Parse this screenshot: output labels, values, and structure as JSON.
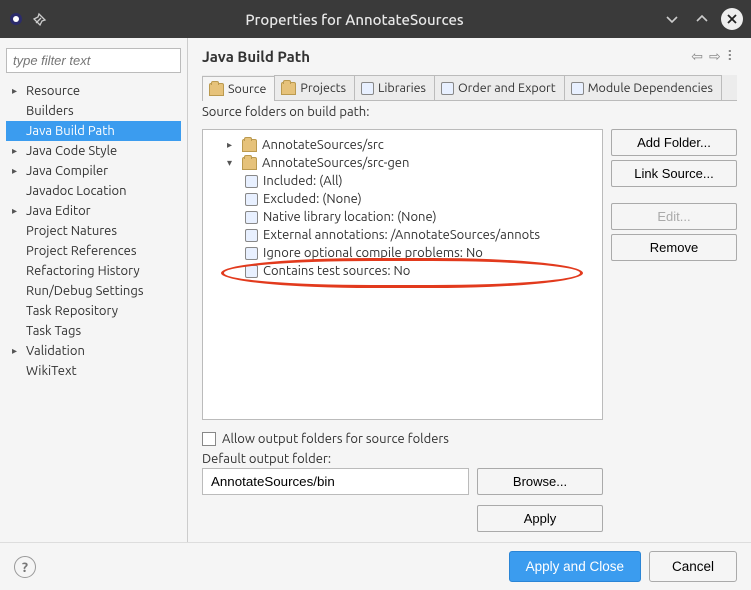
{
  "window": {
    "title": "Properties for AnnotateSources"
  },
  "sidebar": {
    "filter_placeholder": "type filter text",
    "items": [
      {
        "label": "Resource",
        "expander": "▸"
      },
      {
        "label": "Builders"
      },
      {
        "label": "Java Build Path",
        "selected": true
      },
      {
        "label": "Java Code Style",
        "expander": "▸"
      },
      {
        "label": "Java Compiler",
        "expander": "▸"
      },
      {
        "label": "Javadoc Location"
      },
      {
        "label": "Java Editor",
        "expander": "▸"
      },
      {
        "label": "Project Natures"
      },
      {
        "label": "Project References"
      },
      {
        "label": "Refactoring History"
      },
      {
        "label": "Run/Debug Settings"
      },
      {
        "label": "Task Repository"
      },
      {
        "label": "Task Tags"
      },
      {
        "label": "Validation",
        "expander": "▸"
      },
      {
        "label": "WikiText"
      }
    ]
  },
  "main": {
    "title": "Java Build Path",
    "tabs": [
      {
        "label": "Source",
        "active": true
      },
      {
        "label": "Projects"
      },
      {
        "label": "Libraries"
      },
      {
        "label": "Order and Export"
      },
      {
        "label": "Module Dependencies"
      }
    ],
    "src_folders_label": "Source folders on build path:",
    "tree": {
      "root1": "AnnotateSources/src",
      "root2": "AnnotateSources/src-gen",
      "children": [
        "Included: (All)",
        "Excluded: (None)",
        "Native library location: (None)",
        "External annotations: /AnnotateSources/annots",
        "Ignore optional compile problems: No",
        "Contains test sources: No"
      ]
    },
    "buttons": {
      "add_folder": "Add Folder...",
      "link_source": "Link Source...",
      "edit": "Edit...",
      "remove": "Remove"
    },
    "allow_output_label": "Allow output folders for source folders",
    "default_output_label": "Default output folder:",
    "default_output_value": "AnnotateSources/bin",
    "browse": "Browse...",
    "apply": "Apply"
  },
  "footer": {
    "apply_close": "Apply and Close",
    "cancel": "Cancel"
  }
}
